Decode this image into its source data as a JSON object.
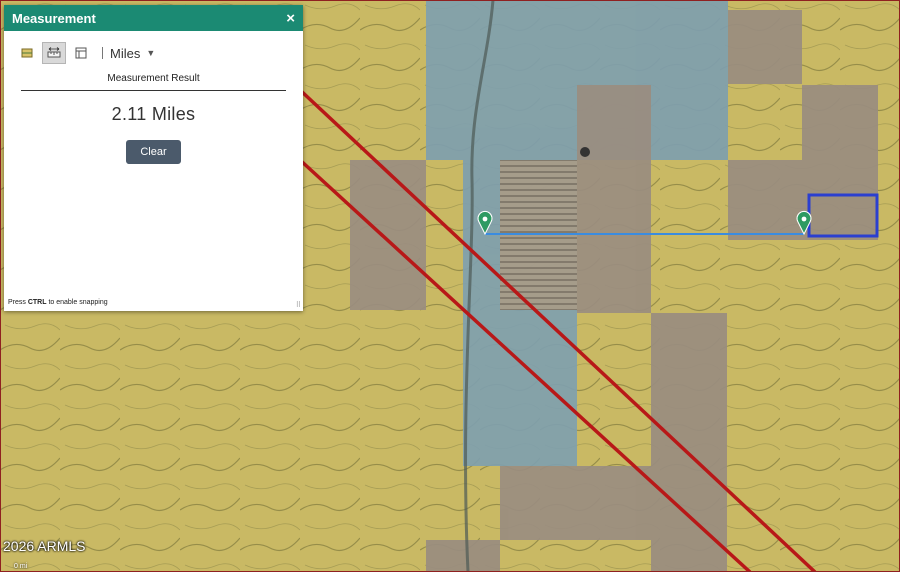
{
  "panel": {
    "title": "Measurement",
    "close_glyph": "×",
    "tools": [
      {
        "icon": "area-measure-icon",
        "active": false
      },
      {
        "icon": "distance-measure-icon",
        "active": true
      },
      {
        "icon": "location-measure-icon",
        "active": false
      }
    ],
    "unit": "Miles",
    "result_label": "Measurement Result",
    "result_value": "2.11 Miles",
    "clear_label": "Clear",
    "hint_prefix": "Press ",
    "hint_key": "CTRL",
    "hint_suffix": " to enable snapping"
  },
  "map": {
    "watermark": "2026 ARMLS",
    "scale_label": "0 mi",
    "colors": {
      "yellow_overlay": "#c9b964",
      "blue_overlay": "#7f9fae",
      "brown_overlay": "#9a8d80",
      "red_line": "#b81818",
      "measure_line": "#3a8ce0",
      "selection_box": "#2b3fd0",
      "marker": "#2e9a62"
    }
  }
}
